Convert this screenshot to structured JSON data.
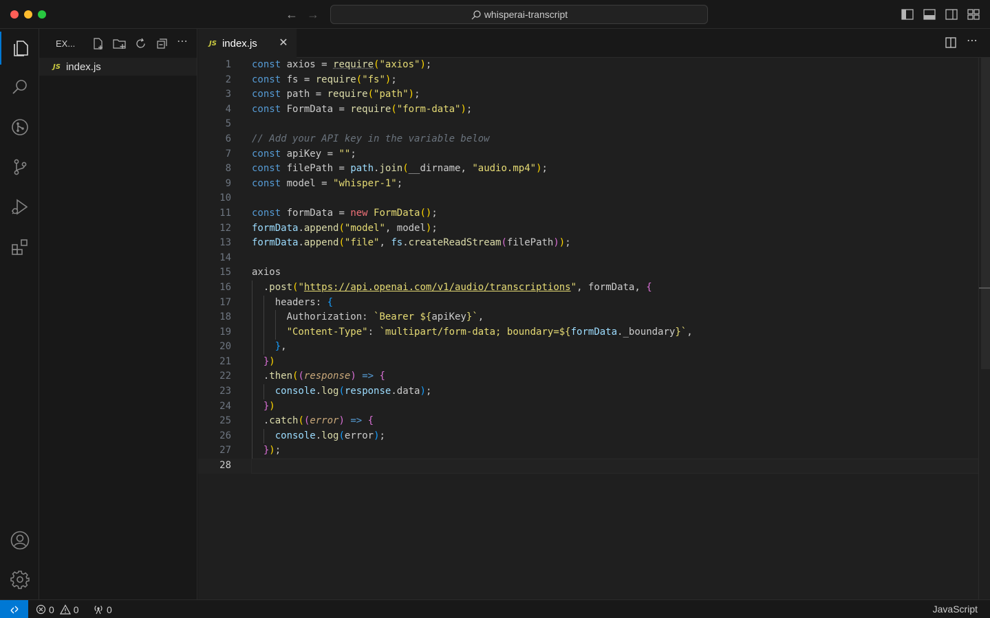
{
  "window": {
    "search_text": "whisperai-transcript"
  },
  "sidebar": {
    "title": "EX...",
    "files": [
      "index.js"
    ],
    "file_badge": "JS"
  },
  "tabs": [
    {
      "badge": "JS",
      "label": "index.js",
      "close": "✕"
    }
  ],
  "editor": {
    "current_line": 28,
    "line_numbers": [
      "1",
      "2",
      "3",
      "4",
      "5",
      "6",
      "7",
      "8",
      "9",
      "10",
      "11",
      "12",
      "13",
      "14",
      "15",
      "16",
      "17",
      "18",
      "19",
      "20",
      "21",
      "22",
      "23",
      "24",
      "25",
      "26",
      "27",
      "28"
    ]
  },
  "statusbar": {
    "errors": "0",
    "warnings": "0",
    "ports": "0",
    "language": "JavaScript"
  },
  "colors": {
    "accent": "#0078d4",
    "keyword": "#569cd6",
    "string": "#e6db74",
    "comment": "#6a737d"
  }
}
